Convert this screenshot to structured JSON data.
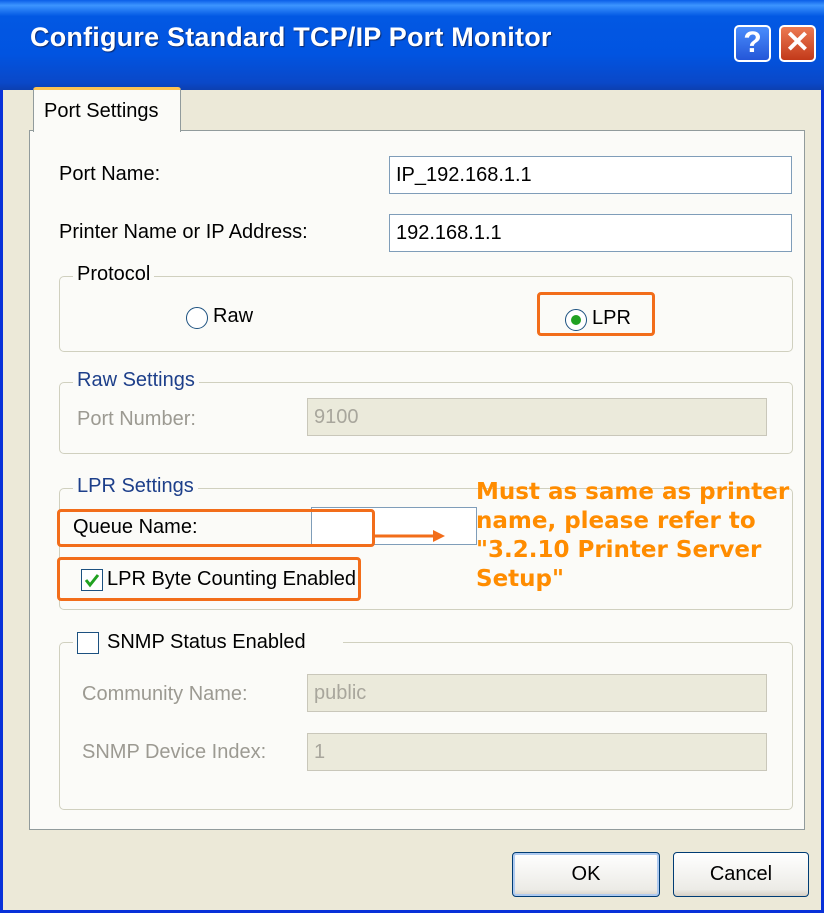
{
  "window": {
    "title": "Configure Standard TCP/IP Port Monitor",
    "help_glyph": "?",
    "close_glyph": "✕"
  },
  "tab": {
    "label": "Port Settings"
  },
  "port_name": {
    "label": "Port Name:",
    "value": "IP_192.168.1.1"
  },
  "printer_address": {
    "label": "Printer Name or IP Address:",
    "value": "192.168.1.1"
  },
  "protocol": {
    "legend": "Protocol",
    "options": [
      {
        "label": "Raw",
        "selected": false
      },
      {
        "label": "LPR",
        "selected": true
      }
    ]
  },
  "raw_settings": {
    "legend": "Raw Settings",
    "port_number_label": "Port Number:",
    "port_number_value": "9100"
  },
  "lpr_settings": {
    "legend": "LPR Settings",
    "queue_name_label": "Queue Name:",
    "queue_name_value": "",
    "byte_counting_label": "LPR Byte Counting Enabled",
    "byte_counting_checked": true
  },
  "snmp": {
    "legend": "SNMP Status Enabled",
    "checked": false,
    "community_label": "Community Name:",
    "community_value": "public",
    "device_index_label": "SNMP Device Index:",
    "device_index_value": "1"
  },
  "annotation": {
    "text": "Must as same as printer name, please refer to \"3.2.10 Printer Server Setup\"",
    "color": "#ff8c00",
    "highlight_color": "#f26d1a"
  },
  "buttons": {
    "ok": "OK",
    "cancel": "Cancel"
  }
}
